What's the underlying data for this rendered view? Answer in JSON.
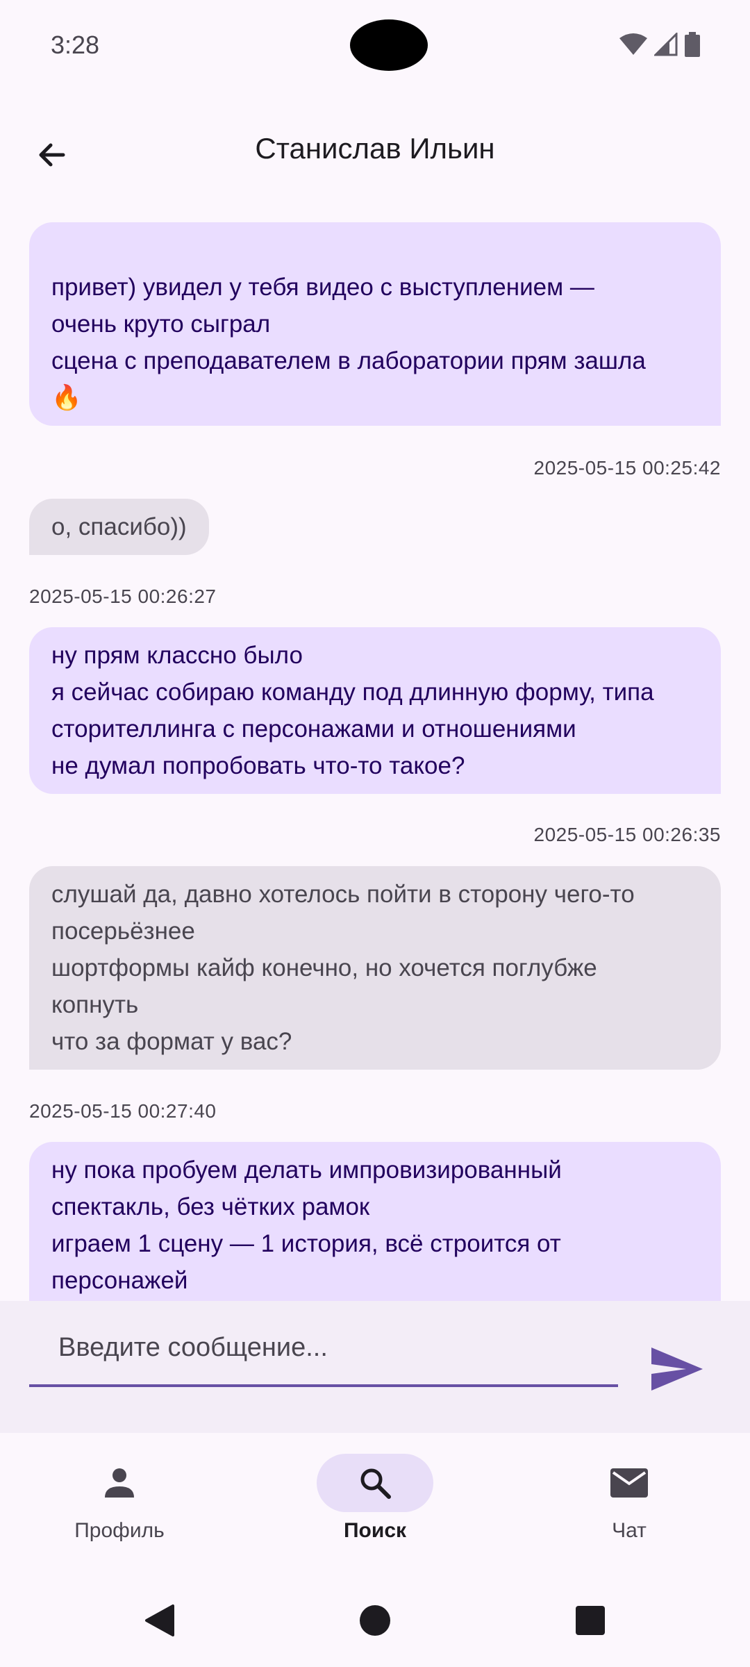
{
  "status_bar": {
    "time": "3:28"
  },
  "top_bar": {
    "title": "Станислав Ильин"
  },
  "messages": [
    {
      "direction": "sent",
      "text": "\nпривет) увидел у тебя видео с выступлением —\nочень круто сыграл\nсцена с преподавателем в лаборатории прям зашла\n🔥",
      "timestamp": "2025-05-15 00:25:42"
    },
    {
      "direction": "received",
      "text": "о, спасибо))",
      "timestamp": "2025-05-15 00:26:27"
    },
    {
      "direction": "sent",
      "text": "ну прям классно было\nя сейчас собираю команду под длинную форму, типа\nсторителлинга с персонажами и отношениями\nне думал попробовать что-то такое?",
      "timestamp": "2025-05-15 00:26:35"
    },
    {
      "direction": "received",
      "text": "слушай да, давно хотелось пойти в сторону чего-то\nпосерьёзнее\nшортформы кайф конечно, но хочется поглубже\nкопнуть\nчто за формат у вас?",
      "timestamp": "2025-05-15 00:27:40"
    },
    {
      "direction": "sent",
      "text": "ну пока пробуем делать импровизированный\nспектакль, без чётких рамок\nиграем 1 сцену — 1 история, всё строится от\nперсонажей",
      "timestamp": ""
    }
  ],
  "composer": {
    "placeholder": "Введите сообщение..."
  },
  "bottom_nav": {
    "items": [
      {
        "label": "Профиль",
        "icon": "person-icon",
        "active": false
      },
      {
        "label": "Поиск",
        "icon": "search-icon",
        "active": true
      },
      {
        "label": "Чат",
        "icon": "mail-icon",
        "active": false
      }
    ]
  },
  "colors": {
    "sent_bubble": "#EADDFF",
    "received_bubble": "#E6E0E9",
    "accent": "#6750A4",
    "background": "#FCF7FD"
  }
}
